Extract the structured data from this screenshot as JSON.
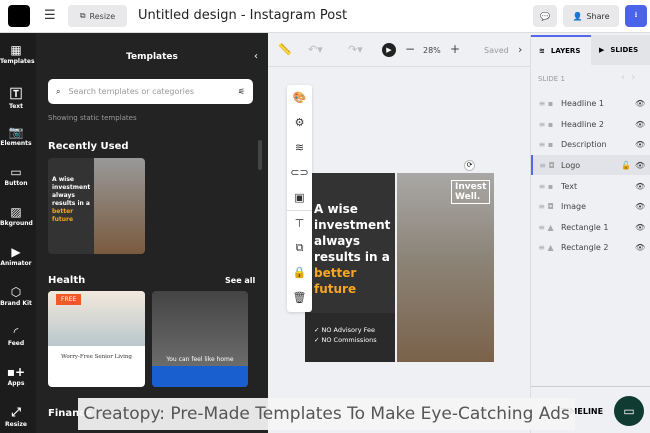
{
  "header": {
    "title": "Untitled design - Instagram Post",
    "resize": "Resize",
    "share": "Share"
  },
  "rail": [
    "Templates",
    "Text",
    "Elements",
    "Button",
    "Bkground",
    "Animator",
    "Brand Kit",
    "Feed",
    "Apps",
    "Resize"
  ],
  "panel": {
    "title": "Templates",
    "search_placeholder": "Search templates or categories",
    "note": "Showing static templates",
    "recent": "Recently Used",
    "health": "Health",
    "see_all": "See all",
    "finance": "Finance"
  },
  "thumbs": {
    "free_badge": "FREE",
    "senior": "Worry-Free Senior Living",
    "home": "You can feel like home"
  },
  "toolbar": {
    "zoom": "28%",
    "saved": "Saved"
  },
  "design": {
    "line1": "A wise",
    "line2": "investment",
    "line3": "always",
    "line4": "results in a",
    "highlight": "better future",
    "check1": "✓ NO Advisory Fee",
    "check2": "✓ NO Commissions",
    "logo1": "Invest",
    "logo2": "Well."
  },
  "right": {
    "layers_tab": "LAYERS",
    "slides_tab": "SLIDES",
    "slide": "SLIDE 1",
    "timeline": "TIMELINE",
    "layers": [
      "Headline 1",
      "Headline 2",
      "Description",
      "Logo",
      "Text",
      "Image",
      "Rectangle 1",
      "Rectangle 2"
    ]
  },
  "caption": "Creatopy: Pre-Made Templates To Make Eye-Catching Ads",
  "colors": {
    "accent": "#f5a623",
    "primary": "#5468e8"
  }
}
